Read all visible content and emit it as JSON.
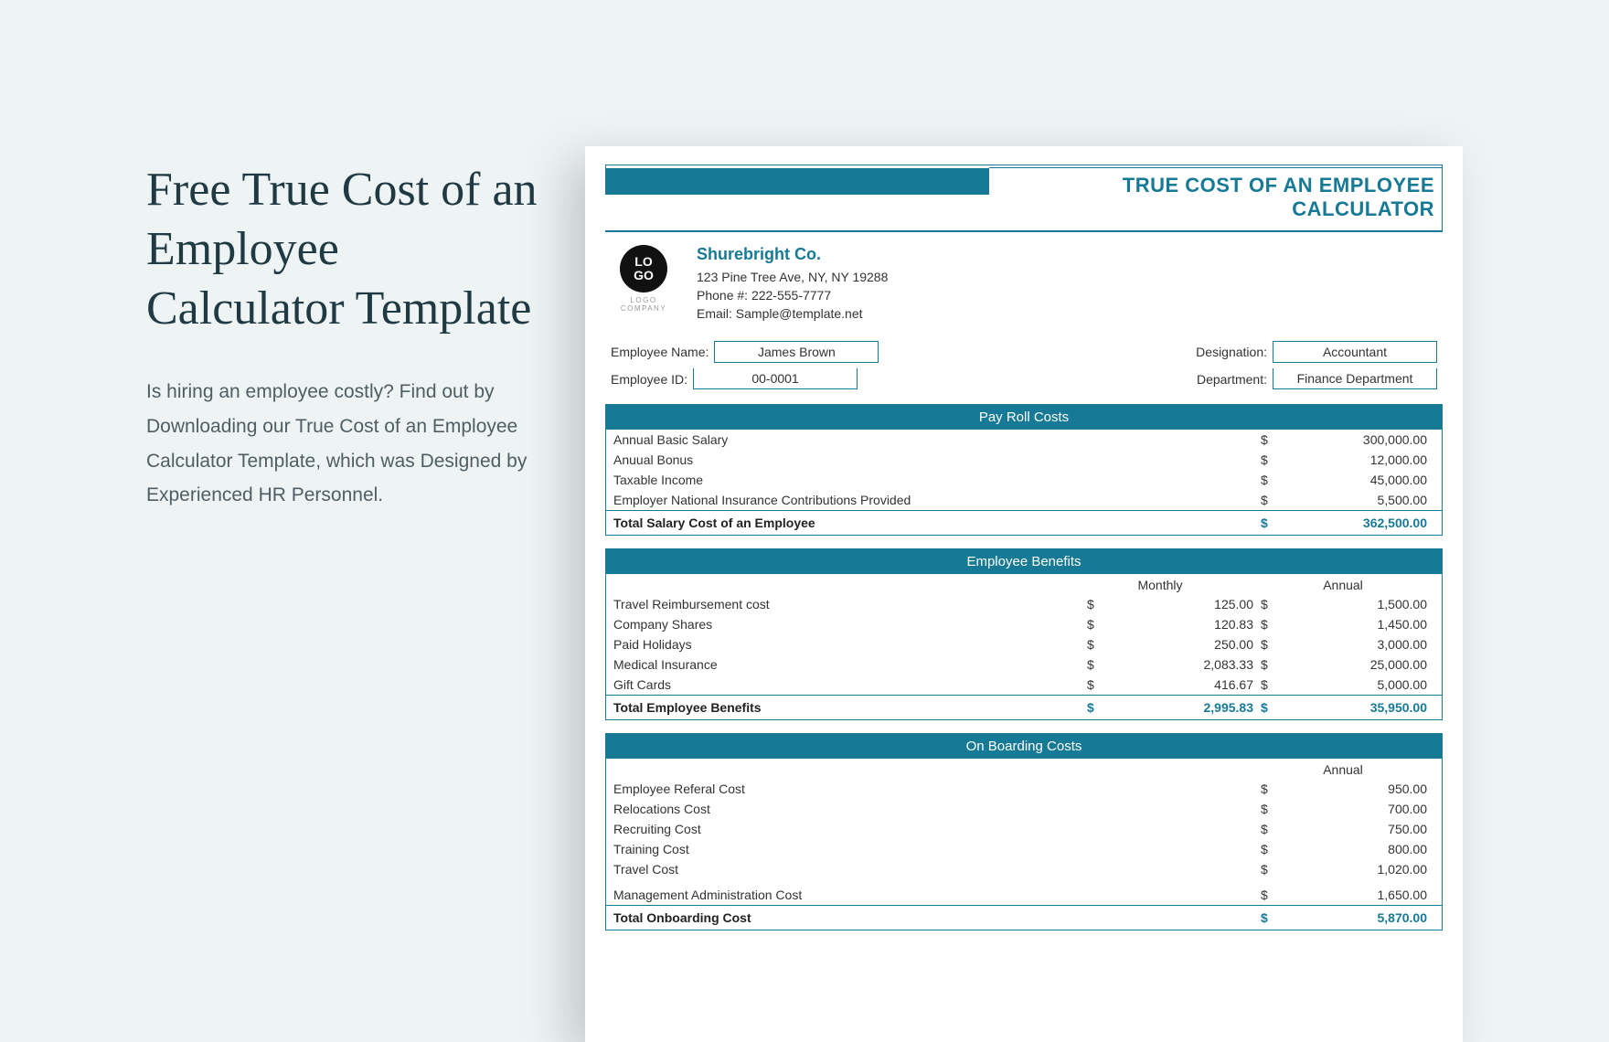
{
  "left": {
    "title": "Free True Cost of an Employee Calculator Template",
    "desc": "Is hiring an employee costly? Find out by Downloading our True Cost of an Employee Calculator Template, which was Designed by Experienced HR Personnel."
  },
  "sheet": {
    "title": "TRUE COST OF AN EMPLOYEE CALCULATOR",
    "logo_text": "LO\nGO",
    "logo_sub": "LOGO COMPANY",
    "company": {
      "name": "Shurebright Co.",
      "addr": "123 Pine Tree Ave, NY, NY  19288",
      "phone": "Phone #: 222-555-7777",
      "email": "Email: Sample@template.net"
    },
    "emp": {
      "name_label": "Employee Name:",
      "name_value": "James Brown",
      "id_label": "Employee ID:",
      "id_value": "00-0001",
      "desig_label": "Designation:",
      "desig_value": "Accountant",
      "dept_label": "Department:",
      "dept_value": "Finance Department"
    },
    "payroll": {
      "head": "Pay Roll Costs",
      "rows": [
        {
          "label": "Annual Basic Salary",
          "val": "300,000.00"
        },
        {
          "label": "Anuual Bonus",
          "val": "12,000.00"
        },
        {
          "label": "Taxable Income",
          "val": "45,000.00"
        },
        {
          "label": "Employer National Insurance Contributions Provided",
          "val": "5,500.00"
        }
      ],
      "total_label": "Total Salary Cost of an Employee",
      "total_val": "362,500.00"
    },
    "benefits": {
      "head": "Employee Benefits",
      "col_monthly": "Monthly",
      "col_annual": "Annual",
      "rows": [
        {
          "label": "Travel Reimbursement cost",
          "m": "125.00",
          "a": "1,500.00"
        },
        {
          "label": "Company Shares",
          "m": "120.83",
          "a": "1,450.00"
        },
        {
          "label": "Paid Holidays",
          "m": "250.00",
          "a": "3,000.00"
        },
        {
          "label": "Medical Insurance",
          "m": "2,083.33",
          "a": "25,000.00"
        },
        {
          "label": "Gift Cards",
          "m": "416.67",
          "a": "5,000.00"
        }
      ],
      "total_label": "Total Employee Benefits",
      "total_m": "2,995.83",
      "total_a": "35,950.00"
    },
    "onboarding": {
      "head": "On Boarding Costs",
      "col_annual": "Annual",
      "rows": [
        {
          "label": "Employee Referal Cost",
          "a": "950.00"
        },
        {
          "label": "Relocations Cost",
          "a": "700.00"
        },
        {
          "label": "Recruiting Cost",
          "a": "750.00"
        },
        {
          "label": "Training Cost",
          "a": "800.00"
        },
        {
          "label": "Travel Cost",
          "a": "1,020.00"
        },
        {
          "label": "Management Administration Cost",
          "a": "1,650.00"
        }
      ],
      "total_label": "Total Onboarding Cost",
      "total_a": "5,870.00"
    },
    "currency": "$"
  }
}
